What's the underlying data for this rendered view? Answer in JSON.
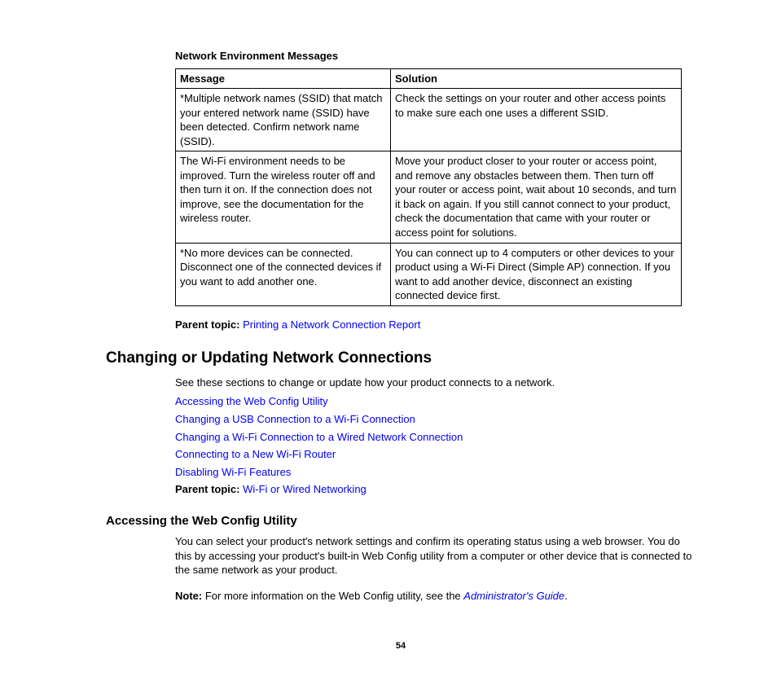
{
  "table": {
    "title": "Network Environment Messages",
    "headers": {
      "message": "Message",
      "solution": "Solution"
    },
    "rows": [
      {
        "message": "*Multiple network names (SSID) that match your entered network name (SSID) have been detected. Confirm network name (SSID).",
        "solution": "Check the settings on your router and other access points to make sure each one uses a different SSID."
      },
      {
        "message": "The Wi-Fi environment needs to be improved. Turn the wireless router off and then turn it on. If the connection does not improve, see the documentation for the wireless router.",
        "solution": "Move your product closer to your router or access point, and remove any obstacles between them. Then turn off your router or access point, wait about 10 seconds, and turn it back on again. If you still cannot connect to your product, check the documentation that came with your router or access point for solutions."
      },
      {
        "message": "*No more devices can be connected. Disconnect one of the connected devices if you want to add another one.",
        "solution": "You can connect up to 4 computers or other devices to your product using a Wi-Fi Direct (Simple AP) connection. If you want to add another device, disconnect an existing connected device first."
      }
    ]
  },
  "parent_topic_1": {
    "label": "Parent topic:",
    "link": "Printing a Network Connection Report"
  },
  "heading_main": "Changing or Updating Network Connections",
  "intro_text": "See these sections to change or update how your product connects to a network.",
  "links": [
    "Accessing the Web Config Utility",
    "Changing a USB Connection to a Wi-Fi Connection",
    "Changing a Wi-Fi Connection to a Wired Network Connection",
    "Connecting to a New Wi-Fi Router",
    "Disabling Wi-Fi Features"
  ],
  "parent_topic_2": {
    "label": "Parent topic:",
    "link": "Wi-Fi or Wired Networking"
  },
  "sub_heading": "Accessing the Web Config Utility",
  "sub_body": "You can select your product's network settings and confirm its operating status using a web browser. You do this by accessing your product's built-in Web Config utility from a computer or other device that is connected to the same network as your product.",
  "note": {
    "label": "Note:",
    "text": " For more information on the Web Config utility, see the ",
    "link": "Administrator's Guide",
    "tail": "."
  },
  "page_number": "54"
}
